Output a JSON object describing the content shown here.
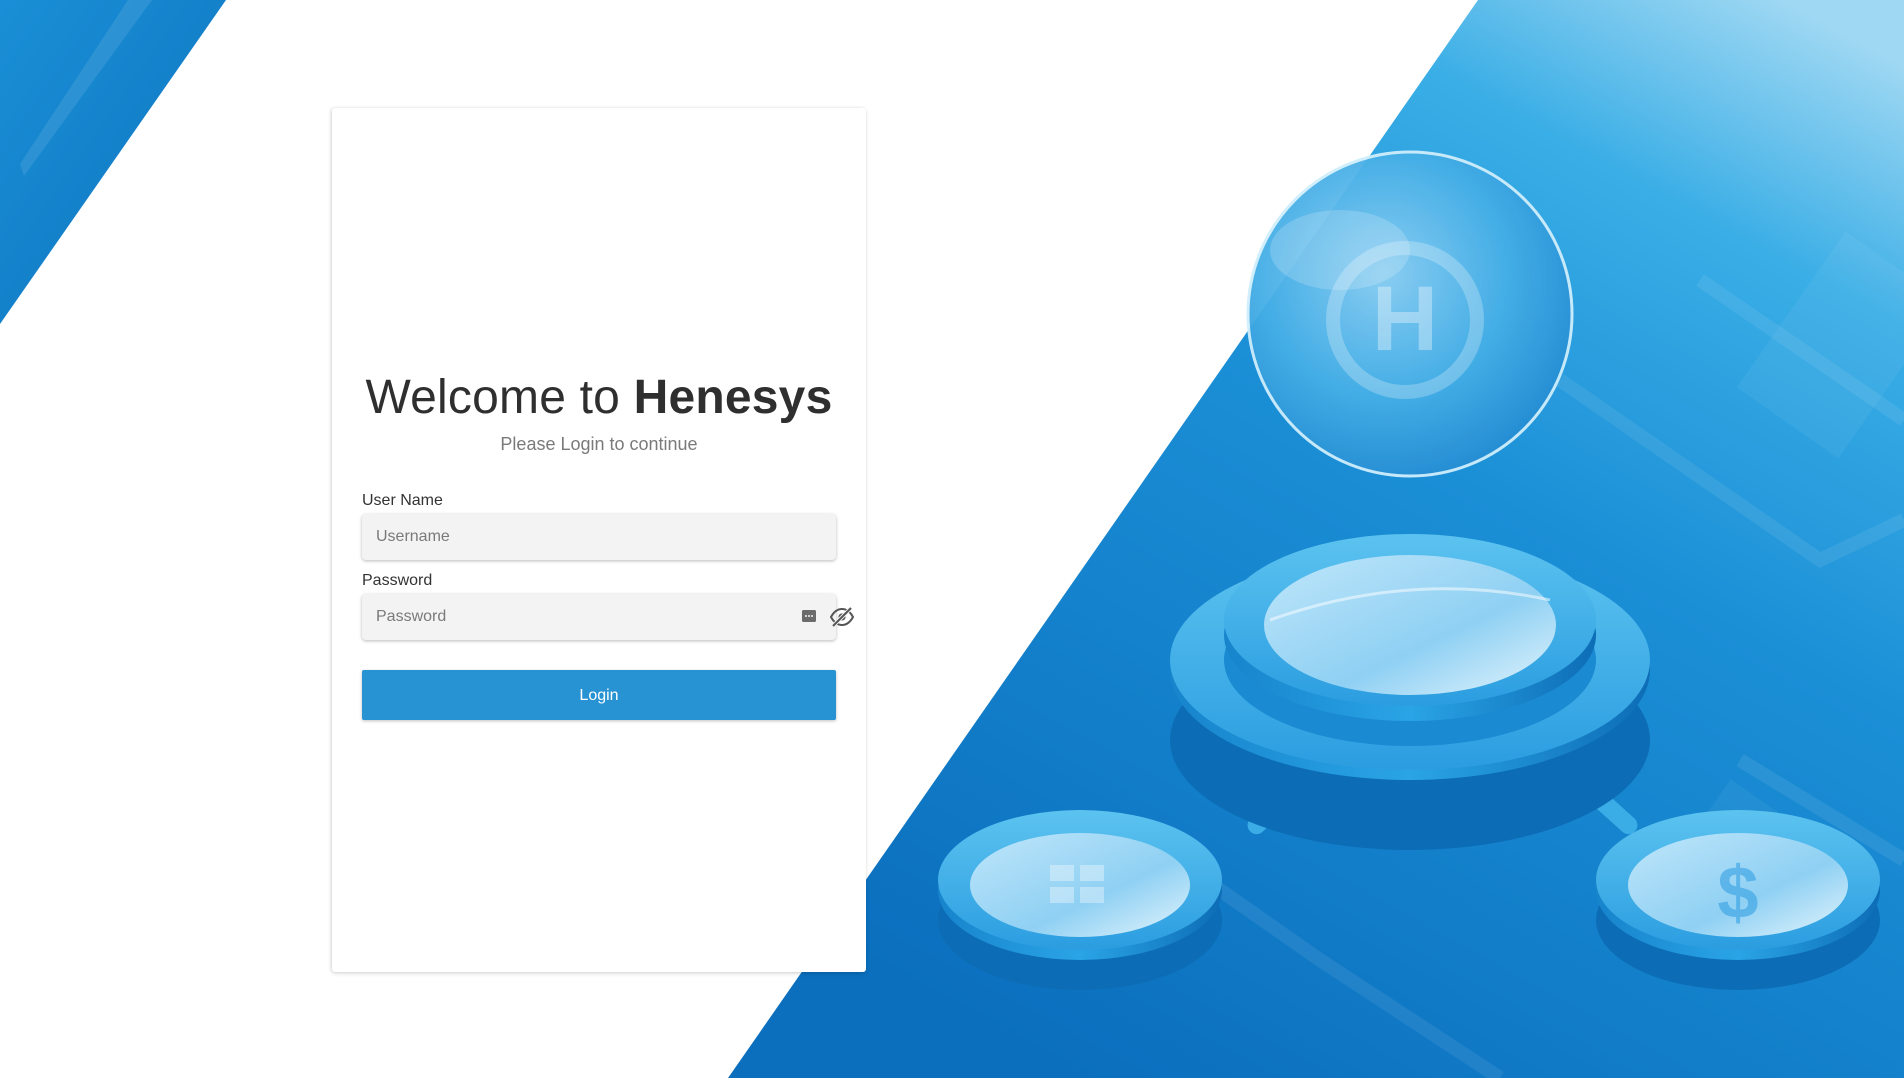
{
  "login": {
    "title_prefix": "Welcome to",
    "title_brand": "Henesys",
    "subtitle": "Please Login to continue",
    "username_label": "User Name",
    "username_placeholder": "Username",
    "username_value": "",
    "password_label": "Password",
    "password_placeholder": "Password",
    "password_value": "",
    "login_button": "Login"
  },
  "icons": {
    "password_manager": "password-manager-icon",
    "visibility_toggle": "eye-off-icon"
  },
  "colors": {
    "accent": "#2793d3",
    "background_blue": "#1587d0",
    "text_dark": "#2f2f2f",
    "text_muted": "#7a7a7a",
    "input_bg": "#f3f3f3"
  }
}
